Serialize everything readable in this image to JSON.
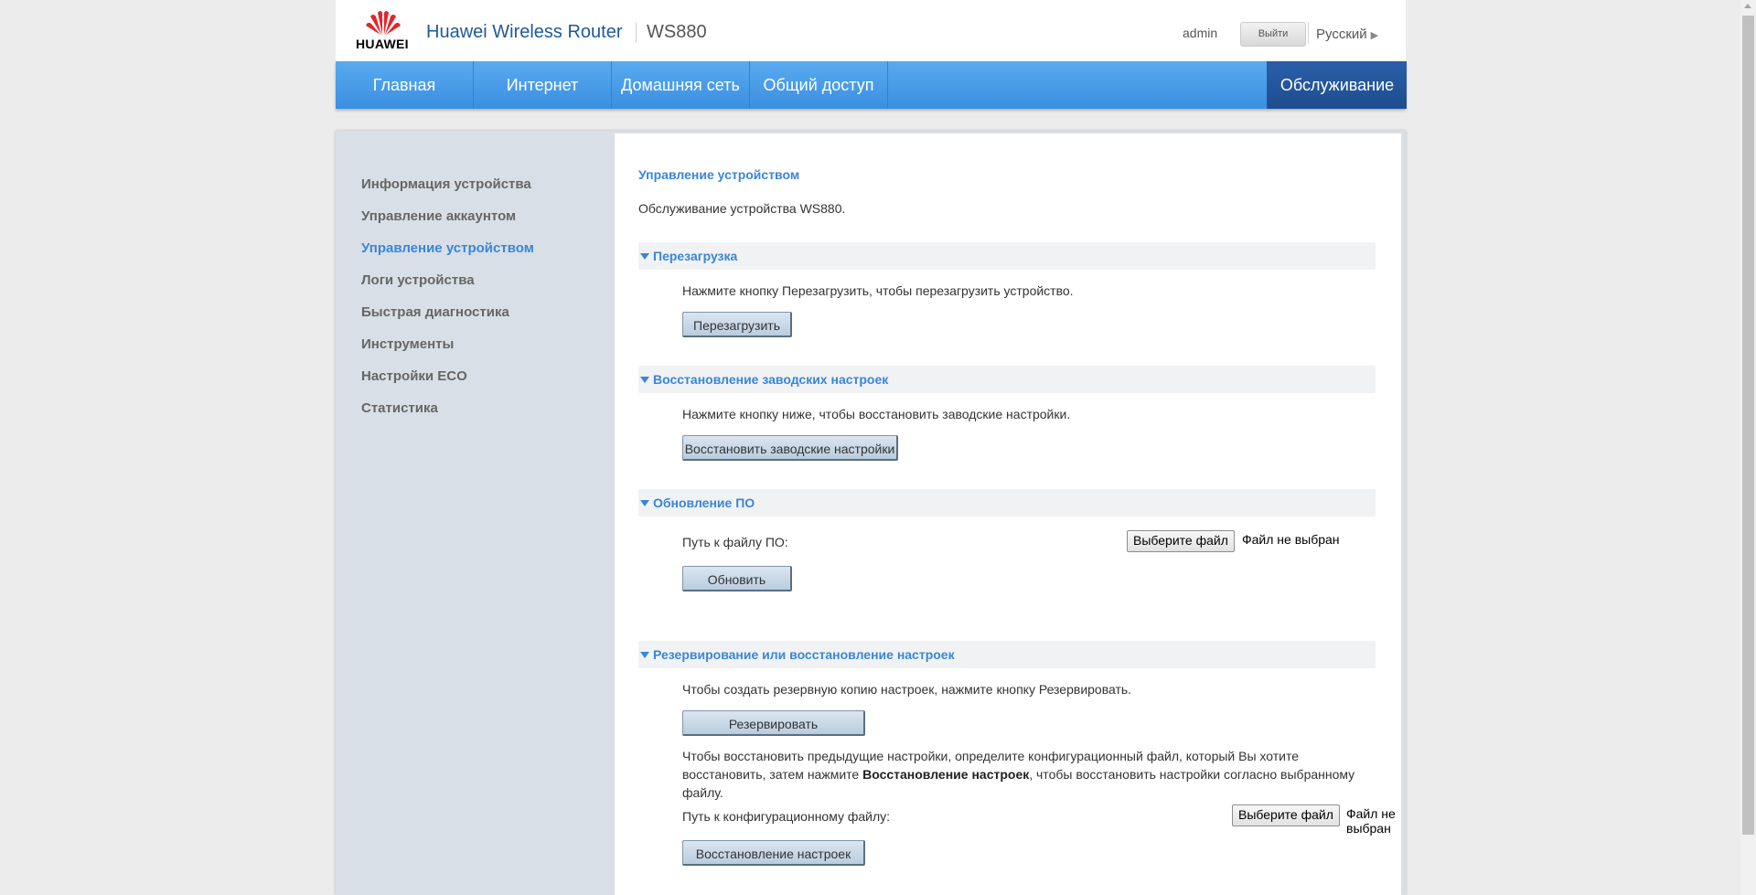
{
  "header": {
    "logo_text": "HUAWEI",
    "app_title": "Huawei Wireless Router",
    "model": "WS880",
    "user": "admin",
    "logout_label": "Выйти",
    "language": "Русский"
  },
  "nav": {
    "items": [
      "Главная",
      "Интернет",
      "Домашняя сеть",
      "Общий доступ",
      "Обслуживание"
    ],
    "active": "Обслуживание"
  },
  "sidebar": {
    "items": [
      "Информация устройства",
      "Управление аккаунтом",
      "Управление устройством",
      "Логи устройства",
      "Быстрая диагностика",
      "Инструменты",
      "Настройки ECO",
      "Статистика"
    ],
    "active": "Управление устройством"
  },
  "main": {
    "title": "Управление устройством",
    "description": "Обслуживание устройства WS880.",
    "reboot": {
      "title": "Перезагрузка",
      "text": "Нажмите кнопку Перезагрузить, чтобы перезагрузить устройство.",
      "button": "Перезагрузить"
    },
    "factory_reset": {
      "title": "Восстановление заводских настроек",
      "text": "Нажмите кнопку ниже, чтобы восстановить заводские настройки.",
      "button": "Восстановить заводские настройки"
    },
    "firmware": {
      "title": "Обновление ПО",
      "path_label": "Путь к файлу ПО:",
      "choose_file": "Выберите файл",
      "no_file": "Файл не выбран",
      "button": "Обновить"
    },
    "backup": {
      "title": "Резервирование или восстановление настроек",
      "backup_text": "Чтобы создать резервную копию настроек, нажмите кнопку Резервировать.",
      "backup_button": "Резервировать",
      "restore_text_1": "Чтобы восстановить предыдущие настройки, определите конфигурационный файл, который Вы хотите восстановить, затем нажмите ",
      "restore_text_bold": "Восстановление настроек",
      "restore_text_2": ", чтобы восстановить настройки согласно выбранному файлу.",
      "path_label": "Путь к конфигурационному файлу:",
      "choose_file": "Выберите файл",
      "no_file": "Файл не выбран",
      "restore_button": "Восстановление настроек"
    }
  },
  "colors": {
    "accent": "#3a86d6",
    "nav_bg": "#4a9ce8",
    "nav_active": "#2559a0",
    "sidebar_bg": "#d8dfe6"
  }
}
